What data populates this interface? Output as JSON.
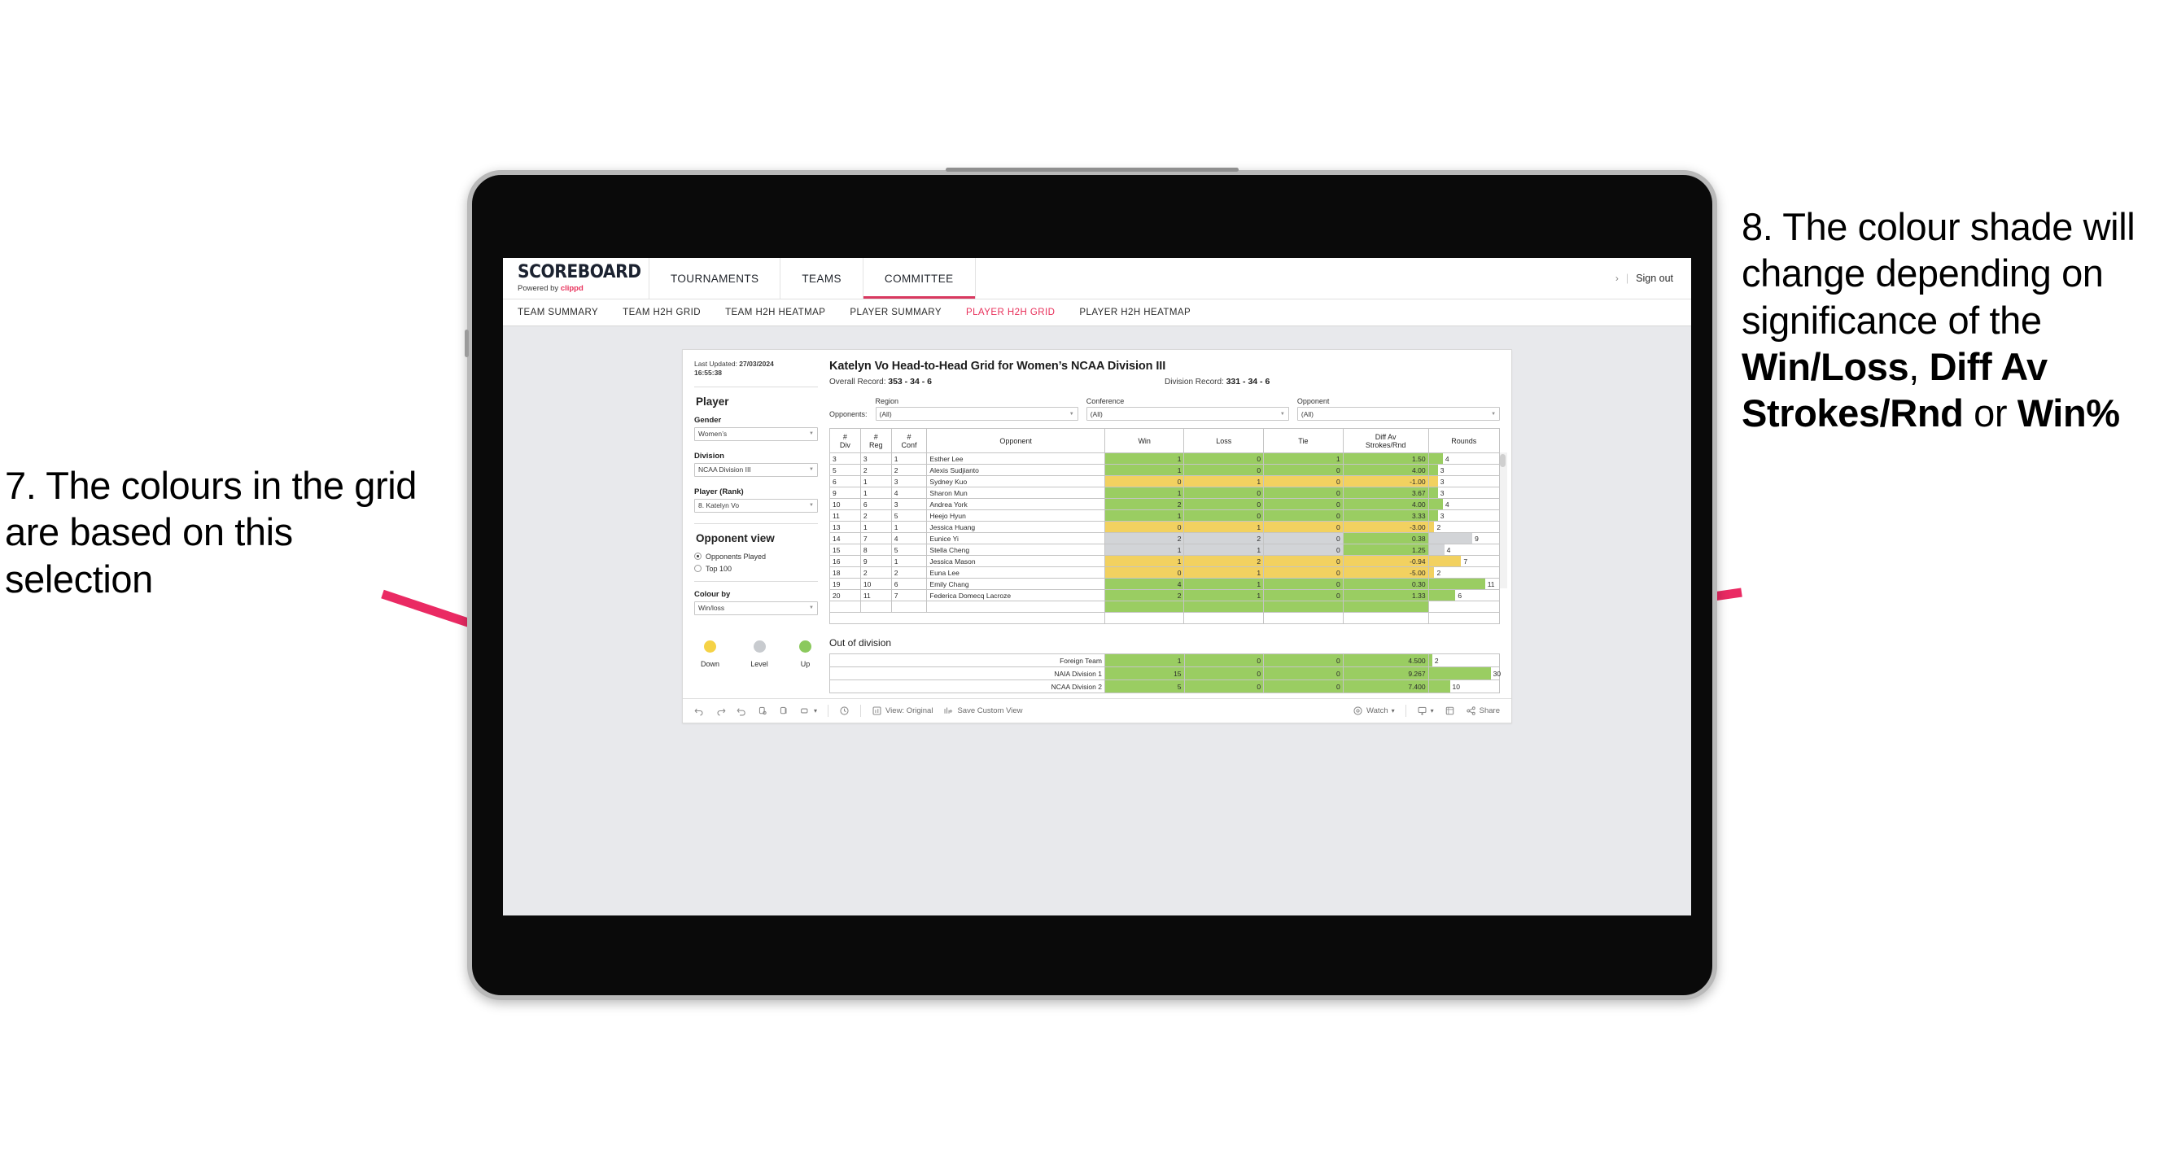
{
  "annotations": {
    "left": {
      "id": "7",
      "text": "7. The colours in the grid are based on this selection"
    },
    "right": {
      "id": "8",
      "pre": "8. The colour shade will change depending on significance of the ",
      "b1": "Win/Loss",
      "mid1": ", ",
      "b2": "Diff Av Strokes/Rnd",
      "mid2": " or ",
      "b3": "Win%"
    },
    "arrow_color": "#ea2a63"
  },
  "header": {
    "logo_main": "SCOREBOARD",
    "logo_sub_prefix": "Powered by ",
    "logo_brand": "clippd",
    "nav": [
      {
        "label": "TOURNAMENTS",
        "active": false
      },
      {
        "label": "TEAMS",
        "active": false
      },
      {
        "label": "COMMITTEE",
        "active": true
      }
    ],
    "chevron": "›",
    "separator": "|",
    "sign_out": "Sign out"
  },
  "subnav": [
    {
      "label": "TEAM SUMMARY",
      "active": false
    },
    {
      "label": "TEAM H2H GRID",
      "active": false
    },
    {
      "label": "TEAM H2H HEATMAP",
      "active": false
    },
    {
      "label": "PLAYER SUMMARY",
      "active": false
    },
    {
      "label": "PLAYER H2H GRID",
      "active": true
    },
    {
      "label": "PLAYER H2H HEATMAP",
      "active": false
    }
  ],
  "sidebar": {
    "updated_label": "Last Updated: ",
    "updated_date": "27/03/2024",
    "updated_time": "16:55:38",
    "player_heading": "Player",
    "filters": [
      {
        "label": "Gender",
        "value": "Women’s"
      },
      {
        "label": "Division",
        "value": "NCAA Division III"
      },
      {
        "label": "Player (Rank)",
        "value": "8. Katelyn Vo"
      }
    ],
    "opponent_view_heading": "Opponent view",
    "radios": [
      {
        "label": "Opponents Played",
        "selected": true
      },
      {
        "label": "Top 100",
        "selected": false
      }
    ],
    "colour_by_label": "Colour by",
    "colour_by_value": "Win/loss",
    "legend": [
      {
        "label": "Down",
        "color": "#f5d246"
      },
      {
        "label": "Level",
        "color": "#c8cbcf"
      },
      {
        "label": "Up",
        "color": "#8bc95d"
      }
    ]
  },
  "viz": {
    "title": "Katelyn Vo Head-to-Head Grid for Women’s NCAA Division III",
    "overall_record_label": "Overall Record: ",
    "overall_record_value": "353 - 34 - 6",
    "division_record_label": "Division Record: ",
    "division_record_value": "331 - 34 - 6",
    "opponents_label": "Opponents:",
    "opponent_filters": [
      {
        "caption": "Region",
        "value": "(All)"
      },
      {
        "caption": "Conference",
        "value": "(All)"
      },
      {
        "caption": "Opponent",
        "value": "(All)"
      }
    ],
    "columns": [
      {
        "l1": "#",
        "l2": "Div"
      },
      {
        "l1": "#",
        "l2": "Reg"
      },
      {
        "l1": "#",
        "l2": "Conf"
      },
      {
        "l1": "Opponent",
        "l2": ""
      },
      {
        "l1": "Win",
        "l2": ""
      },
      {
        "l1": "Loss",
        "l2": ""
      },
      {
        "l1": "Tie",
        "l2": ""
      },
      {
        "l1": "Diff Av",
        "l2": "Strokes/Rnd"
      },
      {
        "l1": "Rounds",
        "l2": ""
      }
    ],
    "out_of_division_title": "Out of division"
  },
  "chart_data": {
    "type": "table",
    "title": "Katelyn Vo Head-to-Head Grid for Women’s NCAA Division III",
    "colour_by": "Win/loss",
    "colors": {
      "up": "#9acd62",
      "down": "#f2d160",
      "level": "#d2d4d7",
      "bar": "#9acd62"
    },
    "columns": [
      "#Div",
      "#Reg",
      "#Conf",
      "Opponent",
      "Win",
      "Loss",
      "Tie",
      "Diff Av Strokes/Rnd",
      "Rounds"
    ],
    "rows": [
      {
        "div": "3",
        "reg": "3",
        "conf": "1",
        "opponent": "Esther Lee",
        "win": "1",
        "loss": "0",
        "tie": "1",
        "diff": "1.50",
        "rounds": "4",
        "rounds_pct": 20,
        "state": "up"
      },
      {
        "div": "5",
        "reg": "2",
        "conf": "2",
        "opponent": "Alexis Sudjianto",
        "win": "1",
        "loss": "0",
        "tie": "0",
        "diff": "4.00",
        "rounds": "3",
        "rounds_pct": 13,
        "state": "up"
      },
      {
        "div": "6",
        "reg": "1",
        "conf": "3",
        "opponent": "Sydney Kuo",
        "win": "0",
        "loss": "1",
        "tie": "0",
        "diff": "-1.00",
        "rounds": "3",
        "rounds_pct": 13,
        "state": "down"
      },
      {
        "div": "9",
        "reg": "1",
        "conf": "4",
        "opponent": "Sharon Mun",
        "win": "1",
        "loss": "0",
        "tie": "0",
        "diff": "3.67",
        "rounds": "3",
        "rounds_pct": 13,
        "state": "up"
      },
      {
        "div": "10",
        "reg": "6",
        "conf": "3",
        "opponent": "Andrea York",
        "win": "2",
        "loss": "0",
        "tie": "0",
        "diff": "4.00",
        "rounds": "4",
        "rounds_pct": 20,
        "state": "up"
      },
      {
        "div": "11",
        "reg": "2",
        "conf": "5",
        "opponent": "Heejo Hyun",
        "win": "1",
        "loss": "0",
        "tie": "0",
        "diff": "3.33",
        "rounds": "3",
        "rounds_pct": 13,
        "state": "up"
      },
      {
        "div": "13",
        "reg": "1",
        "conf": "1",
        "opponent": "Jessica Huang",
        "win": "0",
        "loss": "1",
        "tie": "0",
        "diff": "-3.00",
        "rounds": "2",
        "rounds_pct": 8,
        "state": "down"
      },
      {
        "div": "14",
        "reg": "7",
        "conf": "4",
        "opponent": "Eunice Yi",
        "win": "2",
        "loss": "2",
        "tie": "0",
        "diff": "0.38",
        "rounds": "9",
        "rounds_pct": 62,
        "state": "level",
        "diff_state": "up"
      },
      {
        "div": "15",
        "reg": "8",
        "conf": "5",
        "opponent": "Stella Cheng",
        "win": "1",
        "loss": "1",
        "tie": "0",
        "diff": "1.25",
        "rounds": "4",
        "rounds_pct": 22,
        "state": "level",
        "diff_state": "up"
      },
      {
        "div": "16",
        "reg": "9",
        "conf": "1",
        "opponent": "Jessica Mason",
        "win": "1",
        "loss": "2",
        "tie": "0",
        "diff": "-0.94",
        "rounds": "7",
        "rounds_pct": 46,
        "state": "down"
      },
      {
        "div": "18",
        "reg": "2",
        "conf": "2",
        "opponent": "Euna Lee",
        "win": "0",
        "loss": "1",
        "tie": "0",
        "diff": "-5.00",
        "rounds": "2",
        "rounds_pct": 8,
        "state": "down"
      },
      {
        "div": "19",
        "reg": "10",
        "conf": "6",
        "opponent": "Emily Chang",
        "win": "4",
        "loss": "1",
        "tie": "0",
        "diff": "0.30",
        "rounds": "11",
        "rounds_pct": 80,
        "state": "up"
      },
      {
        "div": "20",
        "reg": "11",
        "conf": "7",
        "opponent": "Federica Domecq Lacroze",
        "win": "2",
        "loss": "1",
        "tie": "0",
        "diff": "1.33",
        "rounds": "6",
        "rounds_pct": 38,
        "state": "up"
      }
    ],
    "out_of_division": [
      {
        "name": "Foreign Team",
        "win": "1",
        "loss": "0",
        "tie": "0",
        "diff": "4.500",
        "rounds": "2",
        "rounds_pct": 5,
        "state": "up"
      },
      {
        "name": "NAIA Division 1",
        "win": "15",
        "loss": "0",
        "tie": "0",
        "diff": "9.267",
        "rounds": "30",
        "rounds_pct": 88,
        "state": "up"
      },
      {
        "name": "NCAA Division 2",
        "win": "5",
        "loss": "0",
        "tie": "0",
        "diff": "7.400",
        "rounds": "10",
        "rounds_pct": 30,
        "state": "up"
      }
    ]
  },
  "toolbar": {
    "view_original": "View: Original",
    "save_custom_view": "Save Custom View",
    "watch": "Watch",
    "share": "Share",
    "caret": "▾"
  }
}
